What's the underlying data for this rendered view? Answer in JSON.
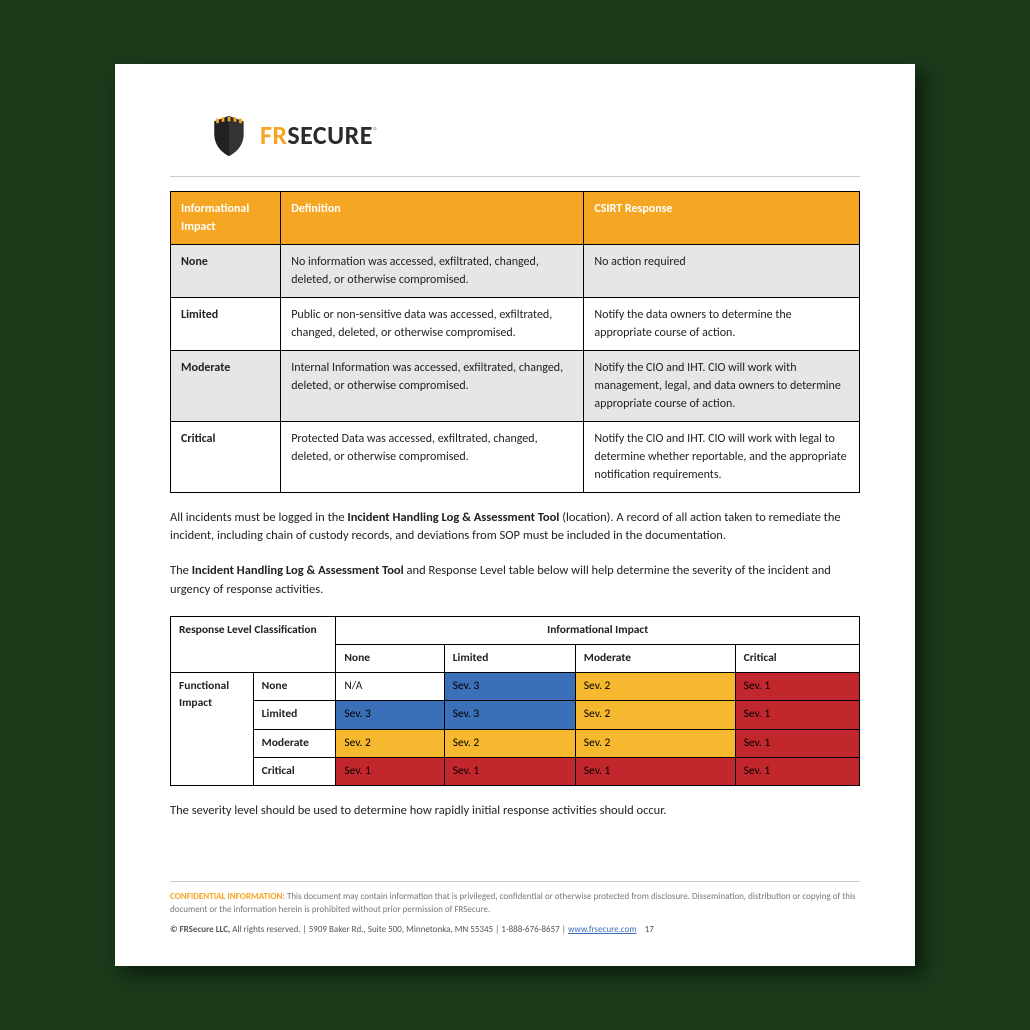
{
  "brand": {
    "part1": "FR",
    "part2": "SECURE",
    "mark": "®"
  },
  "table1": {
    "headers": [
      "Informational Impact",
      "Definition",
      "CSIRT Response"
    ],
    "rows": [
      {
        "level": "None",
        "definition": "No information was accessed, exfiltrated, changed, deleted, or otherwise compromised.",
        "response": "No action required",
        "shade": true
      },
      {
        "level": "Limited",
        "definition": "Public or non-sensitive data was accessed, exfiltrated, changed, deleted, or otherwise compromised.",
        "response": "Notify the data owners to determine the appropriate course of action.",
        "shade": false
      },
      {
        "level": "Moderate",
        "definition": "Internal Information was accessed, exfiltrated, changed, deleted, or otherwise compromised.",
        "response": "Notify the CIO and IHT. CIO will work with management, legal, and data owners to determine appropriate course of action.",
        "shade": true
      },
      {
        "level": "Critical",
        "definition": "Protected Data was accessed, exfiltrated, changed, deleted, or otherwise compromised.",
        "response": "Notify the CIO and IHT. CIO will work with legal to determine whether reportable, and the appropriate notification requirements.",
        "shade": false
      }
    ]
  },
  "para1_pre": "All incidents must be logged in the ",
  "para1_bold": "Incident Handling Log & Assessment Tool",
  "para1_post": " (location).  A record of all action taken to remediate the incident, including chain of custody records, and deviations from SOP must be included in the documentation.",
  "para2_pre": "The ",
  "para2_bold": "Incident Handling Log & Assessment Tool",
  "para2_post": " and Response Level table below will help determine the severity of the incident and urgency of response activities.",
  "table2": {
    "corner": "Response Level Classification",
    "top_group": "Informational Impact",
    "left_group": "Functional Impact",
    "cols": [
      "None",
      "Limited",
      "Moderate",
      "Critical"
    ],
    "rows": [
      {
        "label": "None",
        "cells": [
          {
            "v": "N/A",
            "c": ""
          },
          {
            "v": "Sev. 3",
            "c": "sev-blue"
          },
          {
            "v": "Sev. 2",
            "c": "sev-yellow"
          },
          {
            "v": "Sev. 1",
            "c": "sev-red"
          }
        ]
      },
      {
        "label": "Limited",
        "cells": [
          {
            "v": "Sev. 3",
            "c": "sev-blue"
          },
          {
            "v": "Sev. 3",
            "c": "sev-blue"
          },
          {
            "v": "Sev. 2",
            "c": "sev-yellow"
          },
          {
            "v": "Sev. 1",
            "c": "sev-red"
          }
        ]
      },
      {
        "label": "Moderate",
        "cells": [
          {
            "v": "Sev. 2",
            "c": "sev-yellow"
          },
          {
            "v": "Sev. 2",
            "c": "sev-yellow"
          },
          {
            "v": "Sev. 2",
            "c": "sev-yellow"
          },
          {
            "v": "Sev. 1",
            "c": "sev-red"
          }
        ]
      },
      {
        "label": "Critical",
        "cells": [
          {
            "v": "Sev. 1",
            "c": "sev-red"
          },
          {
            "v": "Sev. 1",
            "c": "sev-red"
          },
          {
            "v": "Sev. 1",
            "c": "sev-red"
          },
          {
            "v": "Sev. 1",
            "c": "sev-red"
          }
        ]
      }
    ]
  },
  "para3": "The severity level should be used to determine how rapidly initial response activities should occur.",
  "footer": {
    "conf_label": "CONFIDENTIAL INFORMATION:",
    "conf_text": " This document may contain information that is privileged, confidential or otherwise protected from disclosure. Dissemination, distribution or copying of this document or the information herein is prohibited without prior permission of FRSecure.",
    "copy_pre": "© FRSecure LLC,",
    "copy_post": " All rights reserved. | 5909 Baker Rd., Suite 500, Minnetonka, MN 55345 | 1-888-676-8657 | ",
    "link": "www.frsecure.com",
    "page_no": "17"
  }
}
